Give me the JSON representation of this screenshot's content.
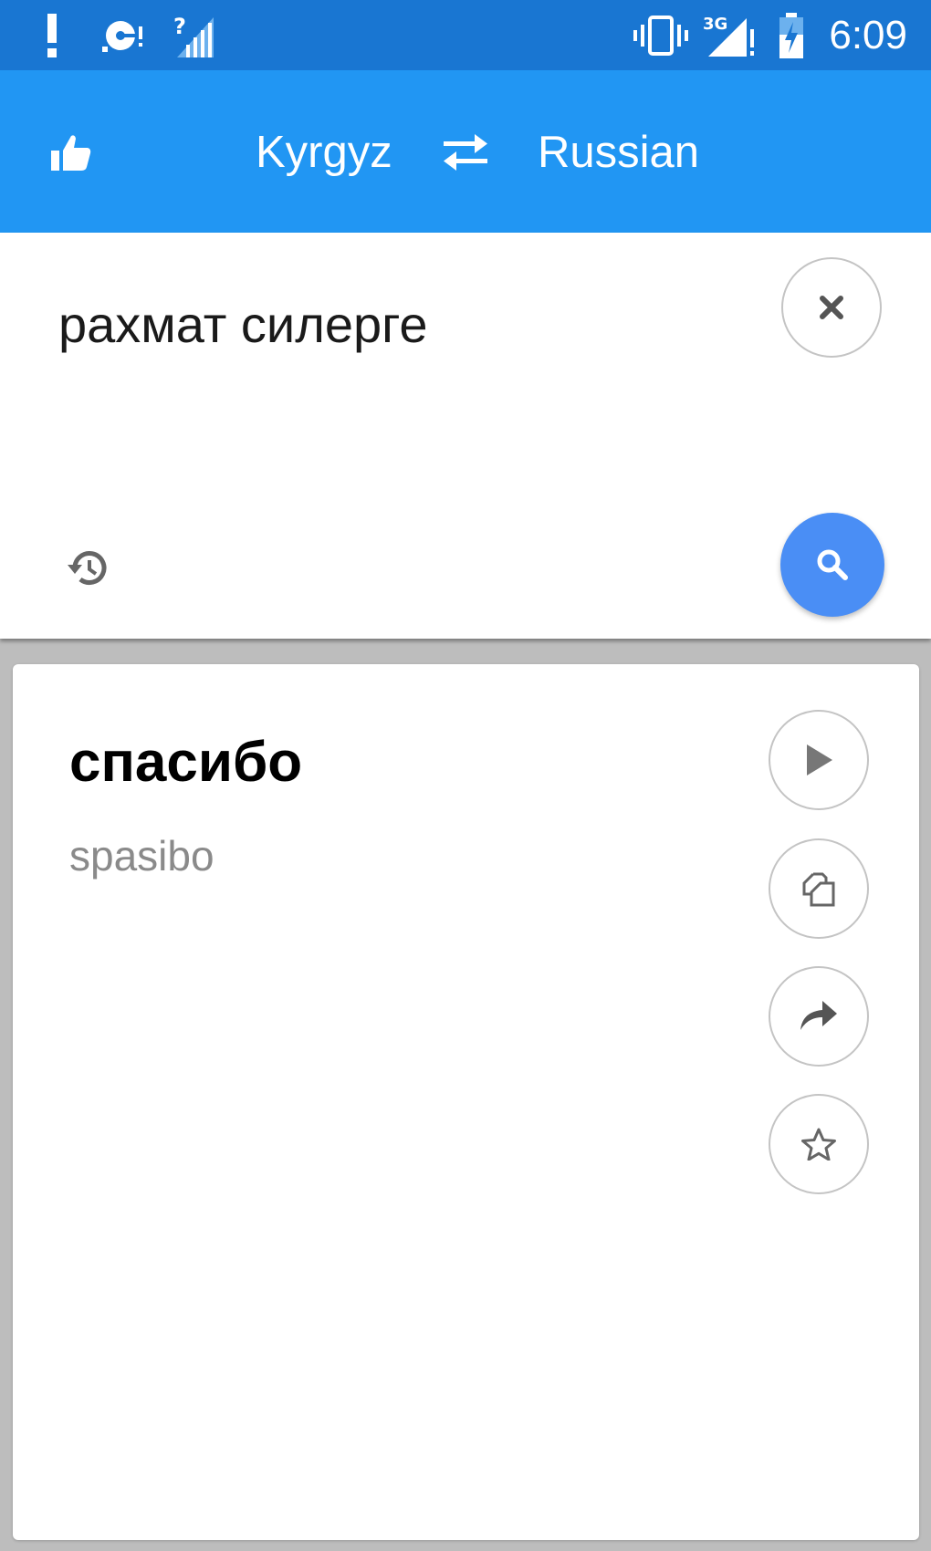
{
  "status_bar": {
    "time": "6:09",
    "network": "3G",
    "icons": [
      "alert-icon",
      "sync-disk-icon",
      "no-signal-icon",
      "vibrate-icon",
      "signal-3g-icon",
      "battery-charging-icon"
    ]
  },
  "app_bar": {
    "source_language": "Kyrgyz",
    "target_language": "Russian",
    "icons": [
      "thumbs-up-icon",
      "swap-icon"
    ]
  },
  "input": {
    "text": "рахмат силерге",
    "icons": [
      "close-icon",
      "history-icon",
      "search-icon"
    ]
  },
  "result": {
    "translation": "спасибо",
    "transliteration": "spasibo",
    "actions": [
      "play-icon",
      "copy-icon",
      "share-icon",
      "star-icon"
    ]
  },
  "colors": {
    "status_bar": "#1976d2",
    "app_bar": "#2196f3",
    "search_button": "#4a8ef5",
    "background": "#bdbdbd"
  }
}
